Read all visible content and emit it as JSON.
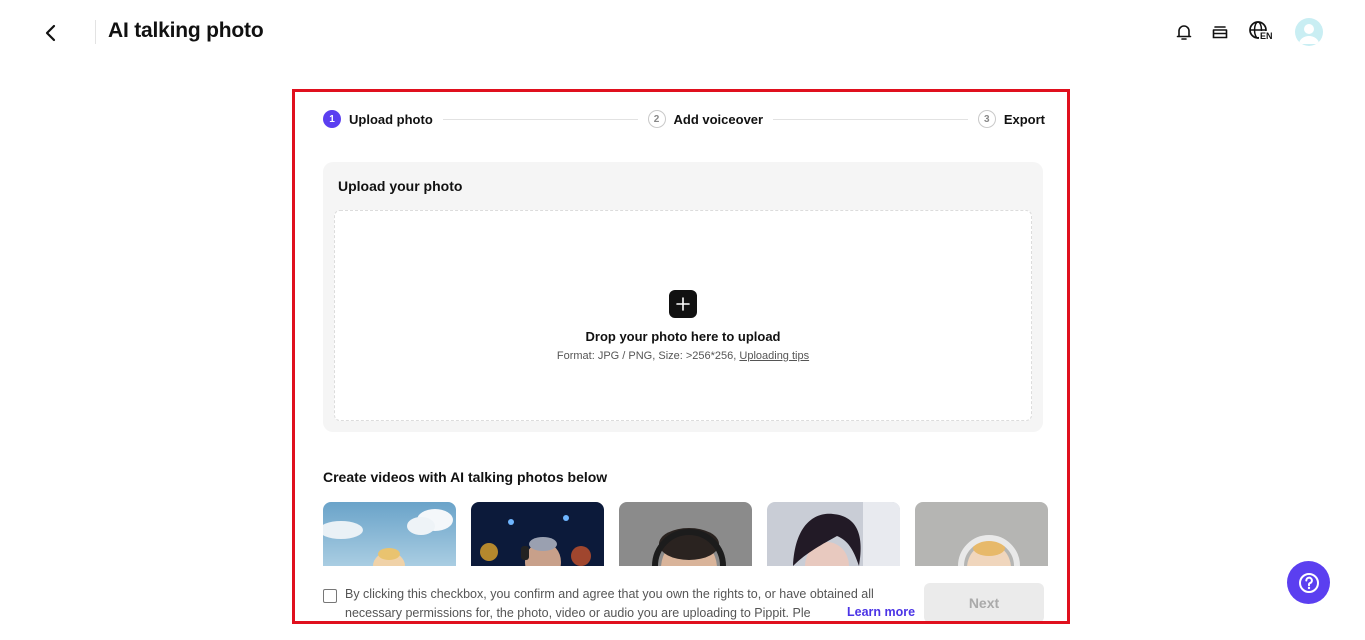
{
  "header": {
    "title": "AI talking photo",
    "language_code": "EN"
  },
  "stepper": {
    "steps": [
      {
        "number": "1",
        "label": "Upload photo",
        "state": "active"
      },
      {
        "number": "2",
        "label": "Add voiceover",
        "state": "idle"
      },
      {
        "number": "3",
        "label": "Export",
        "state": "idle"
      }
    ]
  },
  "upload": {
    "card_title": "Upload your photo",
    "drop_text": "Drop your photo here to upload",
    "format_text": "Format: JPG / PNG, Size: >256*256,",
    "tips_link": "Uploading tips"
  },
  "examples": {
    "title": "Create videos with AI talking photos below",
    "items": [
      "example-1",
      "example-2",
      "example-3",
      "example-4",
      "example-5"
    ]
  },
  "footer": {
    "consent_text": "By clicking this checkbox, you confirm and agree that you own the rights to, or have obtained all necessary permissions for, the photo, video or audio you are uploading to Pippit. Ple",
    "learn_more": "Learn more",
    "next_label": "Next"
  },
  "colors": {
    "accent": "#5b3ff0",
    "highlight_border": "#e0101e",
    "link": "#4b34e6"
  },
  "icons": {
    "back": "chevron-left-icon",
    "notifications": "bell-icon",
    "subscription": "card-stack-icon",
    "language": "globe-icon",
    "plus": "plus-icon",
    "help": "question-icon"
  }
}
